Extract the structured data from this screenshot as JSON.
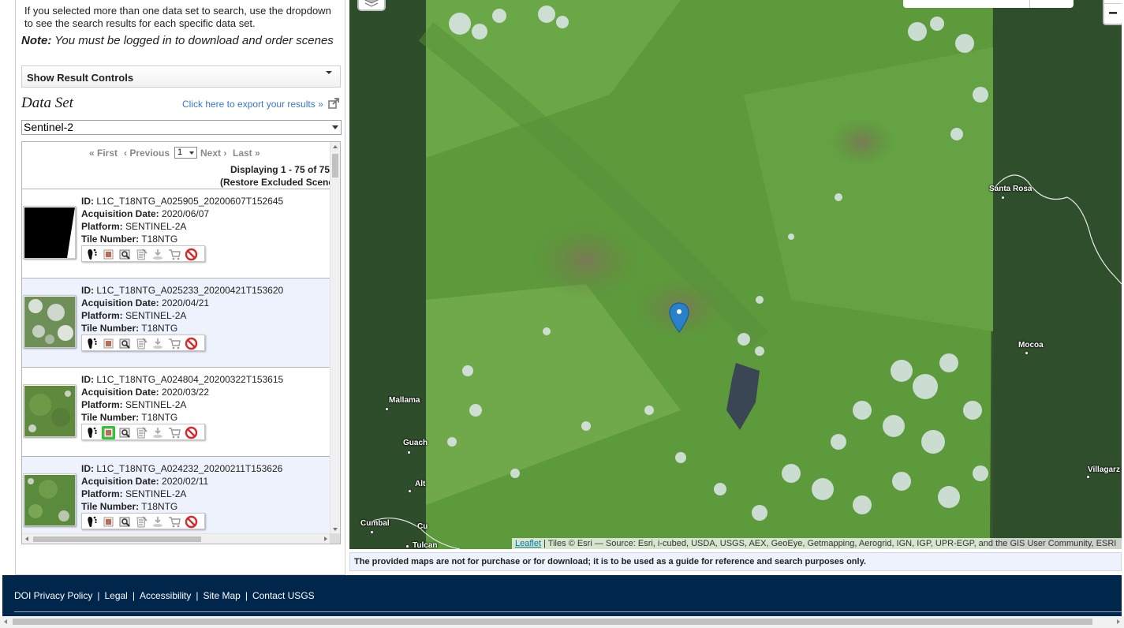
{
  "sidebar": {
    "help_text": "If you selected more than one data set to search, use the dropdown to see the search results for each specific data set.",
    "note_label": "Note:",
    "note_text": " You must be logged in to download and order scenes",
    "result_controls_label": "Show Result Controls",
    "dataset_heading": "Data Set",
    "export_link": "Click here to export your results »",
    "dataset_selected": "Sentinel-2"
  },
  "pager": {
    "first": "« First",
    "previous": "‹ Previous",
    "page_selected": "1",
    "next": "Next ›",
    "last": "Last »",
    "displaying": "Displaying 1 - 75 of 75",
    "restore": "(Restore Excluded Scenes)"
  },
  "labels": {
    "id": "ID:",
    "acquisition_date": "Acquisition Date:",
    "platform": "Platform:",
    "tile_number": "Tile Number:"
  },
  "results": [
    {
      "id": "L1C_T18NTG_A025905_20200607T152645",
      "acquisition_date": "2020/06/07",
      "platform": "SENTINEL-2A",
      "tile_number": "T18NTG",
      "thumb": "partial-black"
    },
    {
      "id": "L1C_T18NTG_A025233_20200421T153620",
      "acquisition_date": "2020/04/21",
      "platform": "SENTINEL-2A",
      "tile_number": "T18NTG",
      "thumb": "cloudy-green"
    },
    {
      "id": "L1C_T18NTG_A024804_20200322T153615",
      "acquisition_date": "2020/03/22",
      "platform": "SENTINEL-2A",
      "tile_number": "T18NTG",
      "thumb": "green"
    },
    {
      "id": "L1C_T18NTG_A024232_20200211T153626",
      "acquisition_date": "2020/02/11",
      "platform": "SENTINEL-2A",
      "tile_number": "T18NTG",
      "thumb": "green"
    }
  ],
  "tool_icons": [
    "footprint-icon",
    "browse-overlay-icon",
    "compare-browse-icon",
    "metadata-icon",
    "download-icon",
    "order-cart-icon",
    "exclude-scene-icon"
  ],
  "map": {
    "attribution_link": "Leaflet",
    "attribution_text": " | Tiles © Esri — Source: Esri, i-cubed, USDA, USGS, AEX, GeoEye, Getmapping, Aerogrid, IGN, IGP, UPR-EGP, and the GIS User Community, ESRI",
    "zoom_out": "−",
    "places": [
      "Santa Rosa",
      "Mocoa",
      "Mallama",
      "Guach",
      "Alt",
      "Cumbal",
      "Cu",
      "Tulcan",
      "Villagarz"
    ]
  },
  "disclaimer": "The provided maps are not for purchase or for download; it is to be used as a guide for reference and search purposes only.",
  "footer": {
    "links": [
      "DOI Privacy Policy",
      "Legal",
      "Accessibility",
      "Site Map",
      "Contact USGS"
    ]
  },
  "colors": {
    "footer_bg": "#00264c",
    "link_blue": "#3b76c9",
    "alt_row": "#eef2fd",
    "highlight_green": "#22cc22"
  }
}
